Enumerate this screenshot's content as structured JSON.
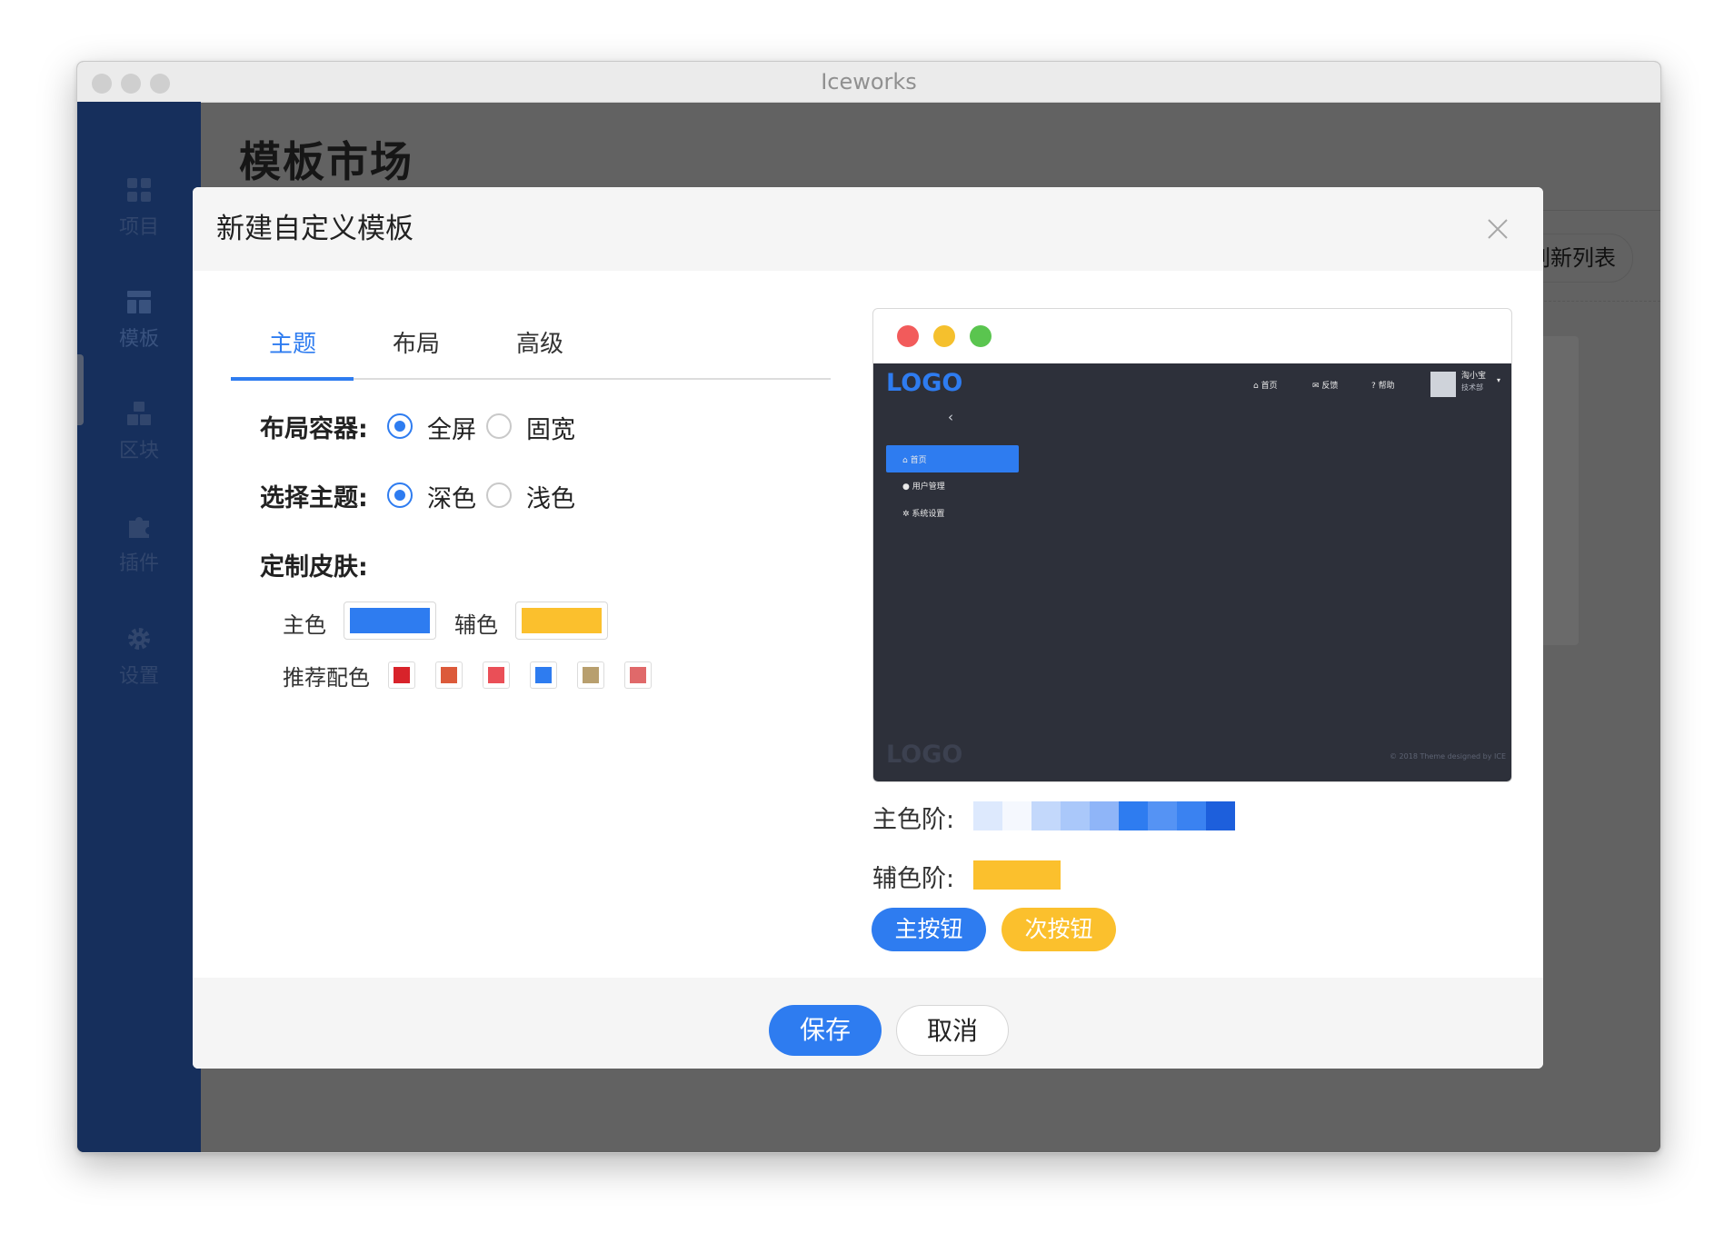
{
  "window": {
    "title": "Iceworks"
  },
  "sidebar": {
    "items": [
      {
        "label": "项目",
        "icon": "grid-icon"
      },
      {
        "label": "模板",
        "icon": "template-icon"
      },
      {
        "label": "区块",
        "icon": "blocks-icon"
      },
      {
        "label": "插件",
        "icon": "puzzle-icon"
      },
      {
        "label": "设置",
        "icon": "gear-icon"
      }
    ]
  },
  "page": {
    "title": "模板市场",
    "refresh_button_label": "刷新列表"
  },
  "dialog": {
    "title": "新建自定义模板",
    "tabs": [
      {
        "label": "主题",
        "active": true
      },
      {
        "label": "布局",
        "active": false
      },
      {
        "label": "高级",
        "active": false
      }
    ],
    "layout_container": {
      "label": "布局容器:",
      "options": [
        {
          "label": "全屏",
          "checked": true
        },
        {
          "label": "固宽",
          "checked": false
        }
      ]
    },
    "theme": {
      "label": "选择主题:",
      "options": [
        {
          "label": "深色",
          "checked": true
        },
        {
          "label": "浅色",
          "checked": false
        }
      ]
    },
    "skin": {
      "label": "定制皮肤:",
      "primary_label": "主色",
      "primary_color": "#2e7cf0",
      "secondary_label": "辅色",
      "secondary_color": "#fbc02d",
      "recommended_label": "推荐配色",
      "recommended_colors": [
        "#d8232a",
        "#dc5a3a",
        "#ea4f57",
        "#2e7cf0",
        "#b89f6e",
        "#e0696a"
      ]
    },
    "preview": {
      "logo": "LOGO",
      "nav": [
        "首页",
        "反馈",
        "帮助"
      ],
      "user_name": "淘小宝",
      "user_dept": "技术部",
      "menu": [
        "首页",
        "用户管理",
        "系统设置"
      ],
      "footer_logo": "LOGO",
      "copyright": "© 2018 Theme designed by ICE",
      "window_dots": [
        "#f25b5b",
        "#f5c02d",
        "#5ac54f"
      ]
    },
    "primary_scale": {
      "label": "主色阶:",
      "colors": [
        "#dde9fd",
        "#f5f8fe",
        "#c3d8fb",
        "#aac8fa",
        "#8fb5f8",
        "#2e7cf0",
        "#5593f4",
        "#3a82f1",
        "#1d5fdc"
      ]
    },
    "secondary_scale": {
      "label": "辅色阶:",
      "colors": [
        "#fbc02d"
      ]
    },
    "primary_button_label": "主按钮",
    "secondary_button_label": "次按钮",
    "save_label": "保存",
    "cancel_label": "取消"
  }
}
